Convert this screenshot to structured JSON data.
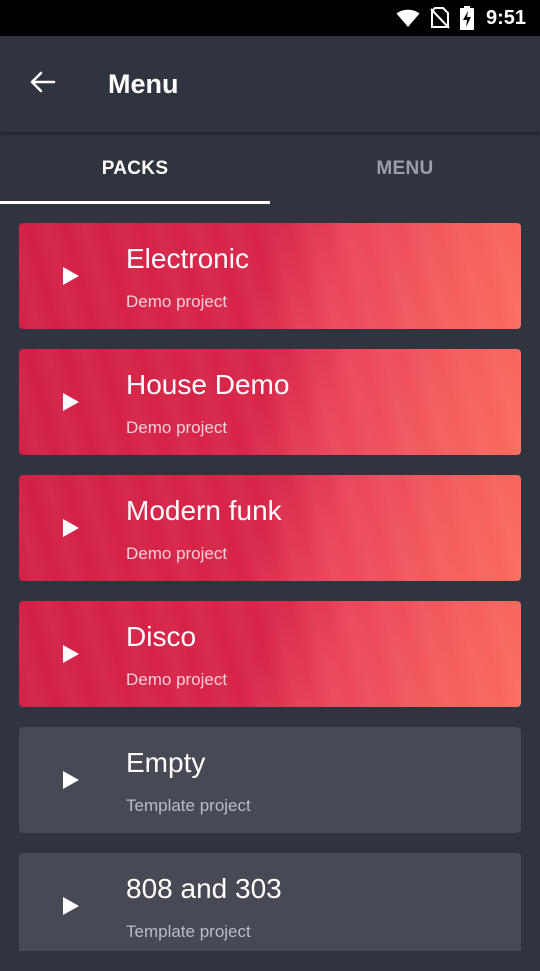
{
  "status": {
    "time": "9:51",
    "icons": [
      "wifi-icon",
      "no-sim-icon",
      "battery-charging-icon"
    ]
  },
  "appbar": {
    "title": "Menu",
    "back_icon": "arrow-left-icon"
  },
  "tabs": [
    {
      "label": "PACKS",
      "active": true
    },
    {
      "label": "MENU",
      "active": false
    }
  ],
  "colors": {
    "background": "#30343e",
    "demo_gradient_start": "#d21f45",
    "demo_gradient_end": "#fb6c5c",
    "template_card": "#474a55",
    "inactive_tab": "#9a9ea8"
  },
  "projects": [
    {
      "title": "Electronic",
      "subtitle": "Demo project",
      "kind": "demo"
    },
    {
      "title": "House Demo",
      "subtitle": "Demo project",
      "kind": "demo"
    },
    {
      "title": "Modern funk",
      "subtitle": "Demo project",
      "kind": "demo"
    },
    {
      "title": "Disco",
      "subtitle": "Demo project",
      "kind": "demo"
    },
    {
      "title": "Empty",
      "subtitle": "Template project",
      "kind": "template"
    },
    {
      "title": "808 and 303",
      "subtitle": "Template project",
      "kind": "template"
    }
  ]
}
